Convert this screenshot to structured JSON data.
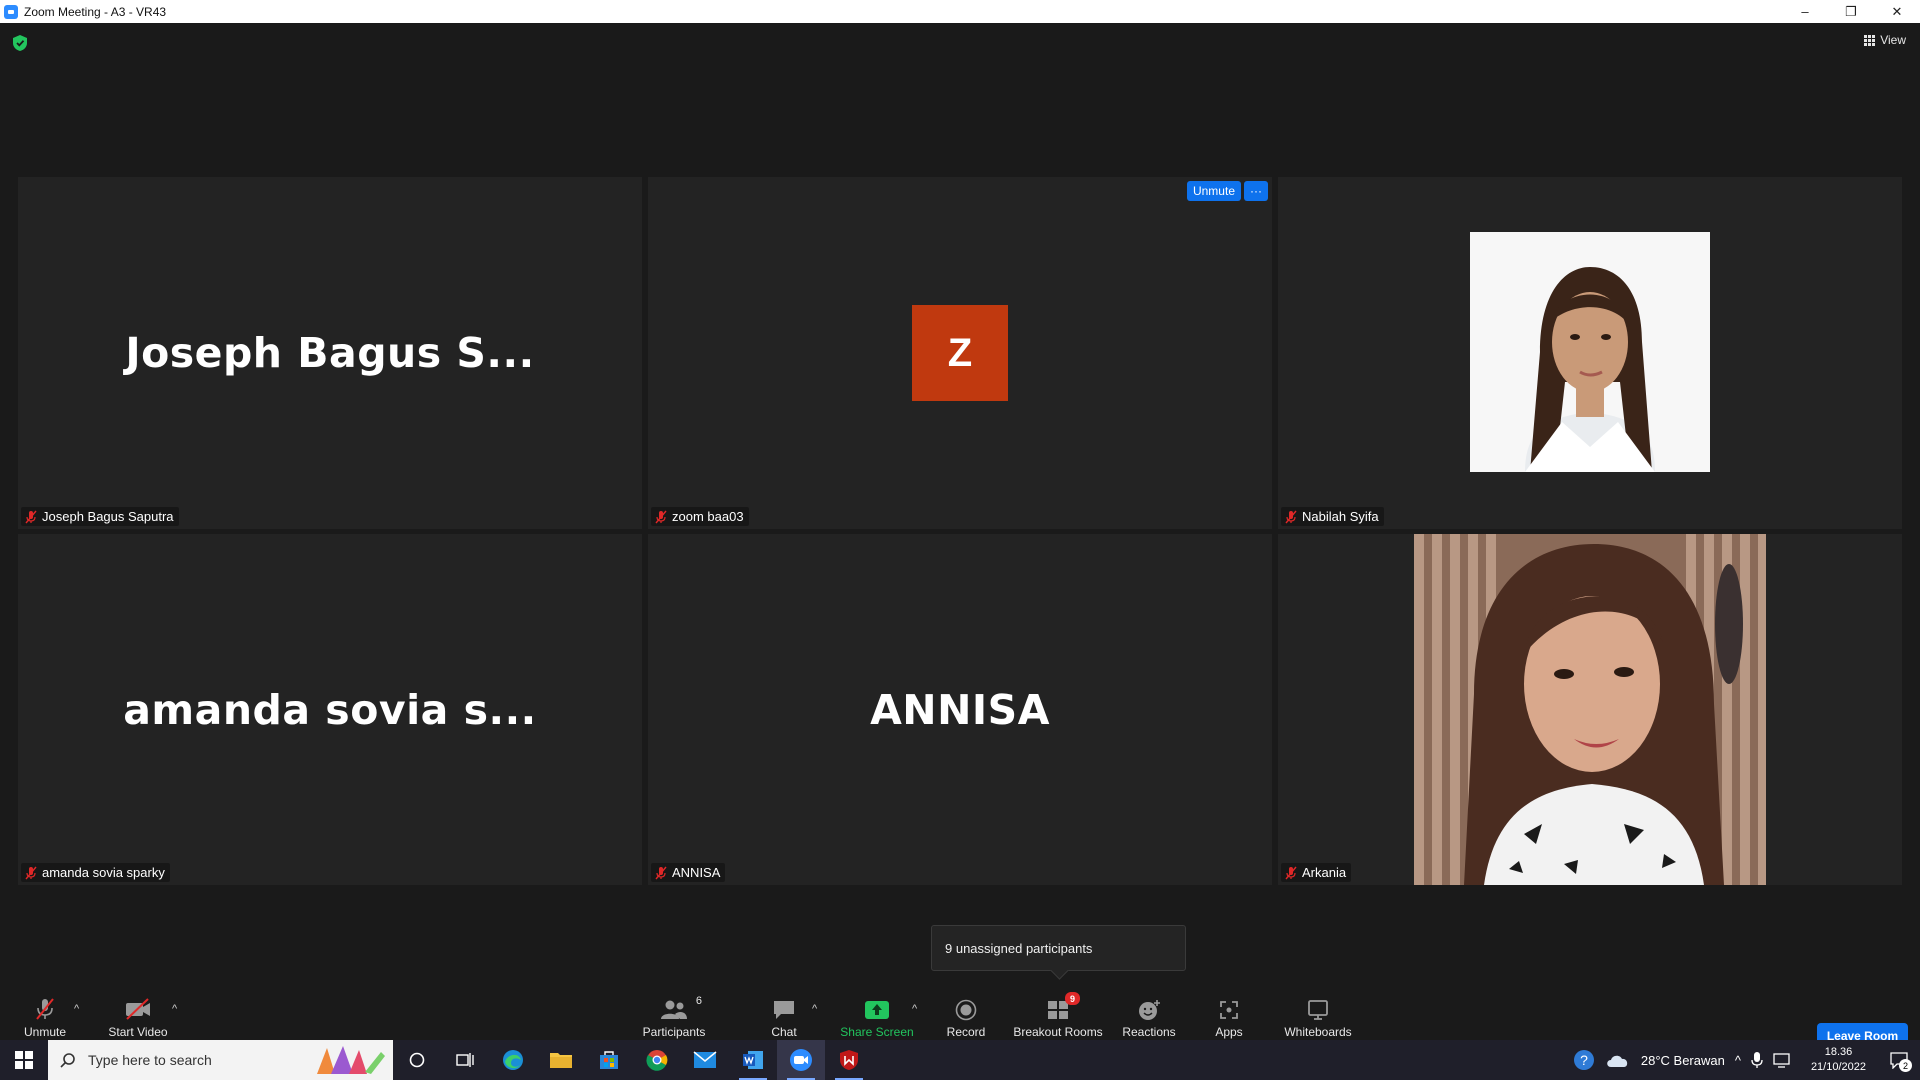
{
  "window": {
    "title": "Zoom Meeting - A3 - VR43",
    "minimize": "–",
    "restore": "❐",
    "close": "✕"
  },
  "header": {
    "view_label": "View"
  },
  "tiles": [
    {
      "big_name": "Joseph Bagus S...",
      "name": "Joseph Bagus Saputra",
      "muted": true
    },
    {
      "avatar_letter": "Z",
      "name": "zoom baa03",
      "muted": true,
      "actions": [
        "Unmute",
        "···"
      ]
    },
    {
      "name": "Nabilah Syifa",
      "muted": true,
      "video": true
    },
    {
      "big_name": "amanda sovia s...",
      "name": "amanda sovia sparky",
      "muted": true
    },
    {
      "big_name": "ANNISA",
      "name": "ANNISA",
      "muted": true
    },
    {
      "name": "Arkania",
      "muted": true,
      "video": true
    }
  ],
  "tooltip": "9 unassigned participants",
  "toolbar": {
    "unmute": "Unmute",
    "start_video": "Start Video",
    "participants": "Participants",
    "participants_count": "6",
    "chat": "Chat",
    "share_screen": "Share Screen",
    "record": "Record",
    "breakout_rooms": "Breakout Rooms",
    "breakout_badge": "9",
    "reactions": "Reactions",
    "apps": "Apps",
    "whiteboards": "Whiteboards",
    "leave_room": "Leave Room",
    "caret": "^"
  },
  "taskbar": {
    "search_placeholder": "Type here to search",
    "weather": "28°C  Berawan",
    "time": "18.36",
    "date": "21/10/2022",
    "notification_count": "2"
  },
  "colors": {
    "accent": "#0e72ed",
    "share_green": "#22c55e",
    "avatar_orange": "#c0390f",
    "muted_red": "#e02828"
  }
}
